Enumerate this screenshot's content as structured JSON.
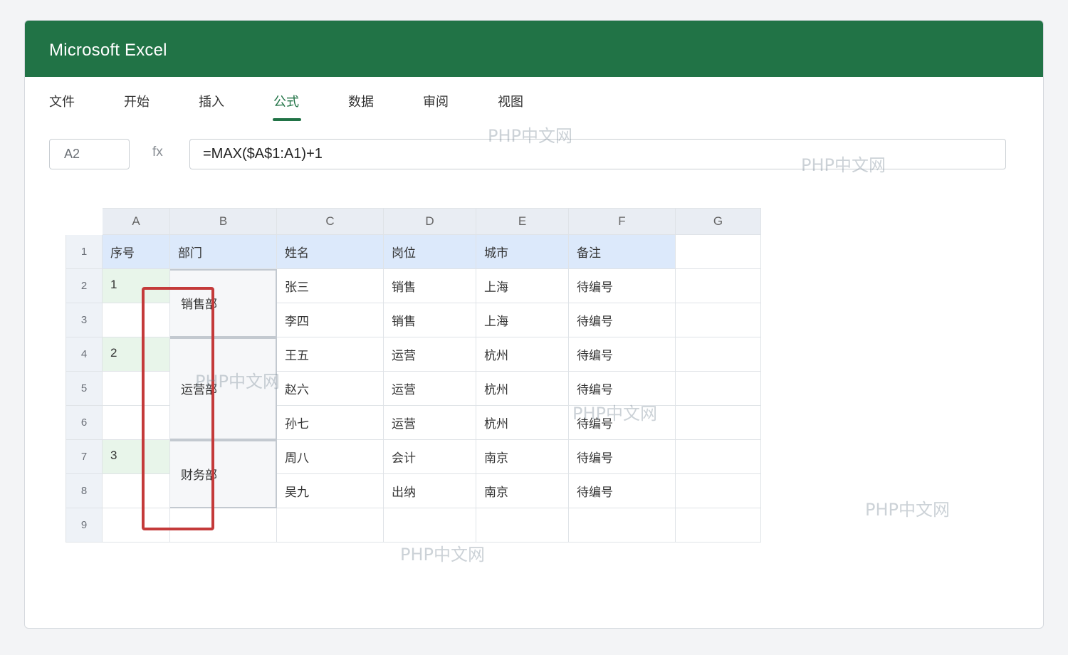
{
  "app": {
    "title": "Microsoft Excel"
  },
  "ribbon": {
    "tabs": [
      {
        "label": "文件",
        "active": false
      },
      {
        "label": "开始",
        "active": false
      },
      {
        "label": "插入",
        "active": false
      },
      {
        "label": "公式",
        "active": true
      },
      {
        "label": "数据",
        "active": false
      },
      {
        "label": "审阅",
        "active": false
      },
      {
        "label": "视图",
        "active": false
      }
    ]
  },
  "formula_bar": {
    "name_box": "A2",
    "fx_label": "fx",
    "formula": "=MAX($A$1:A1)+1"
  },
  "sheet": {
    "columns": [
      "A",
      "B",
      "C",
      "D",
      "E",
      "F",
      "G"
    ],
    "rows": [
      "1",
      "2",
      "3",
      "4",
      "5",
      "6",
      "7",
      "8",
      "9"
    ],
    "header_row": [
      "序号",
      "部门",
      "姓名",
      "岗位",
      "城市",
      "备注",
      ""
    ],
    "serials": [
      "1",
      "",
      "2",
      "",
      "",
      "3",
      ""
    ],
    "departments": [
      {
        "label": "销售部",
        "span": 2
      },
      {
        "label": "运营部",
        "span": 3
      },
      {
        "label": "财务部",
        "span": 2
      }
    ],
    "records": [
      [
        "张三",
        "销售",
        "上海",
        "待编号"
      ],
      [
        "李四",
        "销售",
        "上海",
        "待编号"
      ],
      [
        "王五",
        "运营",
        "杭州",
        "待编号"
      ],
      [
        "赵六",
        "运营",
        "杭州",
        "待编号"
      ],
      [
        "孙七",
        "运营",
        "杭州",
        "待编号"
      ],
      [
        "周八",
        "会计",
        "南京",
        "待编号"
      ],
      [
        "吴九",
        "出纳",
        "南京",
        "待编号"
      ]
    ]
  },
  "colors": {
    "brand": "#217346",
    "highlight_border": "#c43a3a",
    "header_fill": "#dce9fb",
    "serial_fill": "#e8f5ea"
  },
  "watermark": "PHP中文网"
}
